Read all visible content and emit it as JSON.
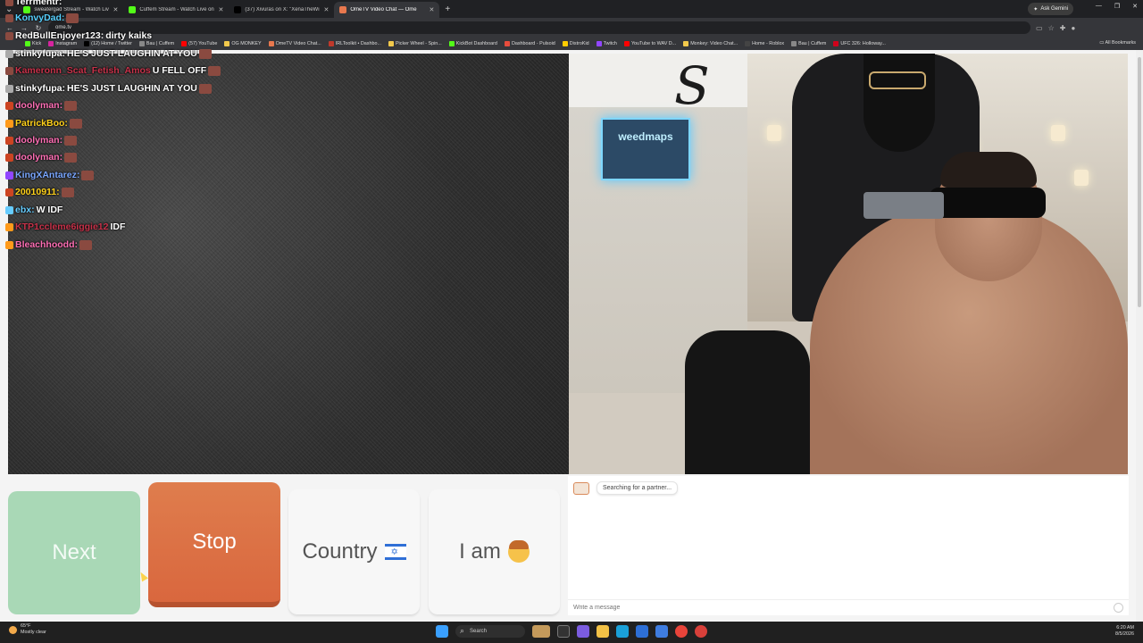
{
  "browser": {
    "tabs": [
      {
        "title": "sweatergad Stream - Watch Liv",
        "color": "#53fc18",
        "active": false
      },
      {
        "title": "Cuffem Stream - Watch Live on",
        "color": "#53fc18",
        "active": false
      },
      {
        "title": "(37) Xivuras on X: \"XenaTheWi",
        "color": "#000000",
        "active": false
      },
      {
        "title": "OmeTV Video Chat — Ome",
        "color": "#e8784e",
        "active": true
      }
    ],
    "new_tab": "+",
    "ask_gemini": "Ask Gemini",
    "url": "ome.tv",
    "bookmarks": [
      {
        "label": "Kick",
        "color": "#53fc18"
      },
      {
        "label": "Instagram",
        "color": "#d6249f"
      },
      {
        "label": "(12) Home / Twitter",
        "color": "#000000"
      },
      {
        "label": "Bau | Cuffem",
        "color": "#888888"
      },
      {
        "label": "(57) YouTube",
        "color": "#ff0000"
      },
      {
        "label": "OG MONKEY",
        "color": "#f2c94c"
      },
      {
        "label": "OmeTV Video Chat...",
        "color": "#e8784e"
      },
      {
        "label": "IRLToolkit • Dashbo...",
        "color": "#c0392b"
      },
      {
        "label": "Picker Wheel - Spin...",
        "color": "#f2c94c"
      },
      {
        "label": "KickBot Dashboard",
        "color": "#53fc18"
      },
      {
        "label": "Dashboard - Pulsoid",
        "color": "#e74c3c"
      },
      {
        "label": "DistroKid",
        "color": "#ffcc00"
      },
      {
        "label": "Twitch",
        "color": "#9146ff"
      },
      {
        "label": "YouTube to WAV D...",
        "color": "#ff0000"
      },
      {
        "label": "Monkey: Video Chat...",
        "color": "#f2c94c"
      },
      {
        "label": "Home - Roblox",
        "color": "#444444"
      },
      {
        "label": "Bau | Cuffem",
        "color": "#888888"
      },
      {
        "label": "UFC 326: Holloway...",
        "color": "#d0021b"
      }
    ],
    "all_bookmarks": "All Bookmarks"
  },
  "chat": [
    {
      "user": "Terrmentr:",
      "user_color": "#ffffff",
      "message": "",
      "emote": false
    },
    {
      "user": "KonvyDad:",
      "user_color": "#57d0ff",
      "message": "",
      "emote": true
    },
    {
      "user": "RedBullEnjoyer123:",
      "user_color": "#ffffff",
      "message": "dirty kaiks",
      "emote": false
    },
    {
      "user": "stinkyfupa:",
      "user_color": "#ffffff",
      "message": "HE'S JUST LAUGHIN AT YOU",
      "emote": true
    },
    {
      "user": "Kameronn_Scat_Fetish_Amos",
      "user_color": "#c8324a",
      "message": "U FELL OFF",
      "emote": true
    },
    {
      "user": "stinkyfupa:",
      "user_color": "#ffffff",
      "message": "HE'S JUST LAUGHIN AT YOU",
      "emote": true
    },
    {
      "user": "doolyman:",
      "user_color": "#ff6fb5",
      "message": "",
      "emote": true
    },
    {
      "user": "PatrickBoo:",
      "user_color": "#ffd11a",
      "message": "",
      "emote": true
    },
    {
      "user": "doolyman:",
      "user_color": "#ff6fb5",
      "message": "",
      "emote": true
    },
    {
      "user": "doolyman:",
      "user_color": "#ff6fb5",
      "message": "",
      "emote": true
    },
    {
      "user": "KingXAntarez:",
      "user_color": "#7aa7ff",
      "message": "",
      "emote": true
    },
    {
      "user": "20010911:",
      "user_color": "#ffd11a",
      "message": "",
      "emote": true
    },
    {
      "user": "ebx:",
      "user_color": "#66ccff",
      "message": "W  IDF",
      "emote": false
    },
    {
      "user": "KTP1ccleme6iggie12",
      "user_color": "#c8324a",
      "message": "IDF",
      "emote": false
    },
    {
      "user": "Bleachhoodd:",
      "user_color": "#ff6fb5",
      "message": "",
      "emote": true
    }
  ],
  "right_video": {
    "neon_sign": "weedmaps"
  },
  "controls": {
    "next": "Next",
    "stop": "Stop",
    "country": "Country",
    "iam": "I am"
  },
  "chatpanel": {
    "status": "Searching for a partner...",
    "placeholder": "Write a message"
  },
  "taskbar": {
    "temp": "65°F",
    "weather": "Mostly clear",
    "search": "Search",
    "time": "6:20 AM",
    "date": "8/5/2026"
  }
}
